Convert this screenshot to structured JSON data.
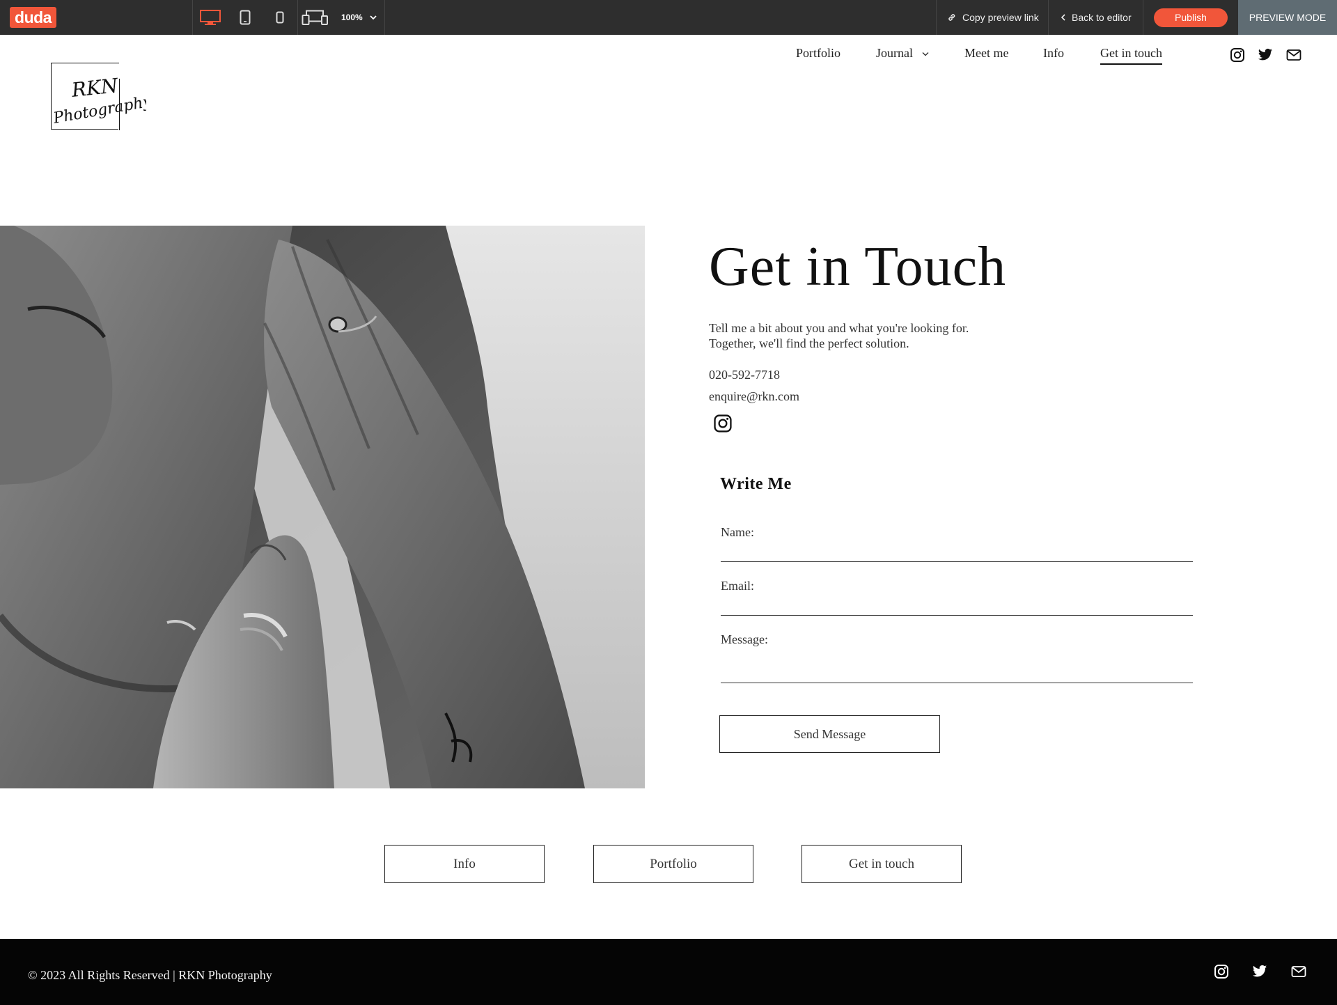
{
  "toolbar": {
    "brand": "duda",
    "zoom": "100%",
    "copy_link": "Copy preview link",
    "back": "Back to editor",
    "publish": "Publish",
    "mode": "PREVIEW MODE",
    "accent": "#f1563a"
  },
  "site": {
    "logo_line1": "RKN",
    "logo_line2": "Photography"
  },
  "nav": {
    "items": [
      {
        "label": "Portfolio"
      },
      {
        "label": "Journal",
        "has_dropdown": true
      },
      {
        "label": "Meet me"
      },
      {
        "label": "Info"
      },
      {
        "label": "Get in touch",
        "active": true
      }
    ],
    "social": [
      "instagram-icon",
      "twitter-icon",
      "mail-icon"
    ]
  },
  "main": {
    "title": "Get in Touch",
    "intro_line1": "Tell me a bit about you and what you're looking for.",
    "intro_line2": "Together, we'll find the perfect solution.",
    "phone": "020-592-7718",
    "email": "enquire@rkn.com"
  },
  "form": {
    "title": "Write Me",
    "name_label": "Name:",
    "email_label": "Email:",
    "message_label": "Message:",
    "submit": "Send Message"
  },
  "bottom_buttons": [
    "Info",
    "Portfolio",
    "Get in touch"
  ],
  "footer": {
    "copyright": "© 2023 All Rights Reserved | RKN Photography"
  }
}
